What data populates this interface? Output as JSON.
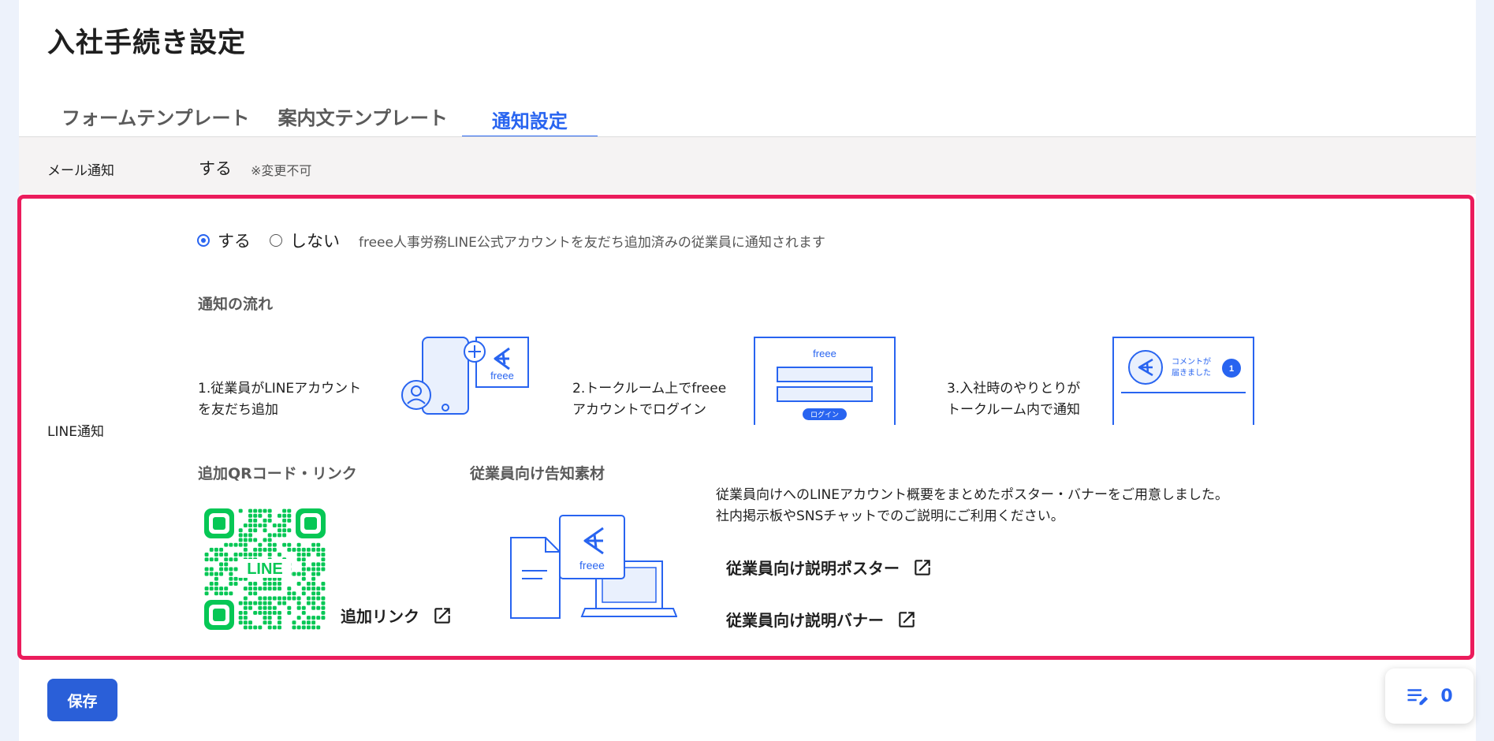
{
  "page": {
    "title": "入社手続き設定"
  },
  "tabs": [
    {
      "label": "フォームテンプレート"
    },
    {
      "label": "案内文テンプレート"
    },
    {
      "label": "通知設定"
    }
  ],
  "mail": {
    "label": "メール通知",
    "value": "する",
    "note": "※変更不可"
  },
  "line": {
    "label": "LINE通知",
    "option_yes": "する",
    "option_no": "しない",
    "selected": "する",
    "description": "freee人事労務LINE公式アカウントを友だち追加済みの従業員に通知されます"
  },
  "flow": {
    "heading": "通知の流れ",
    "steps": [
      {
        "line1": "1.従業員がLINEアカウント",
        "line2": "を友だち追加"
      },
      {
        "line1": "2.トークルーム上でfreee",
        "line2": "アカウントでログイン"
      },
      {
        "line1": "3.入社時のやりとりが",
        "line2": "トークルーム内で通知"
      }
    ]
  },
  "illustrations": {
    "logo_text": "freee",
    "login_button": "ログイン",
    "notice_line1": "コメントが",
    "notice_line2": "届きました",
    "notice_count": "1",
    "qr_text": "LINE"
  },
  "qr": {
    "heading": "追加QRコード・リンク",
    "link_label": "追加リンク"
  },
  "materials": {
    "heading": "従業員向け告知素材",
    "desc_line1": "従業員向けへのLINEアカウント概要をまとめたポスター・バナーをご用意しました。",
    "desc_line2": "社内掲示板やSNSチャットでのご説明にご利用ください。",
    "poster_link": "従業員向け説明ポスター",
    "banner_link": "従業員向け説明バナー"
  },
  "actions": {
    "save_label": "保存"
  },
  "fab": {
    "count": "0"
  },
  "colors": {
    "accent": "#2864f0",
    "highlight": "#eb1c5c",
    "line_green": "#06c755",
    "save_button": "#2a5fd8"
  }
}
